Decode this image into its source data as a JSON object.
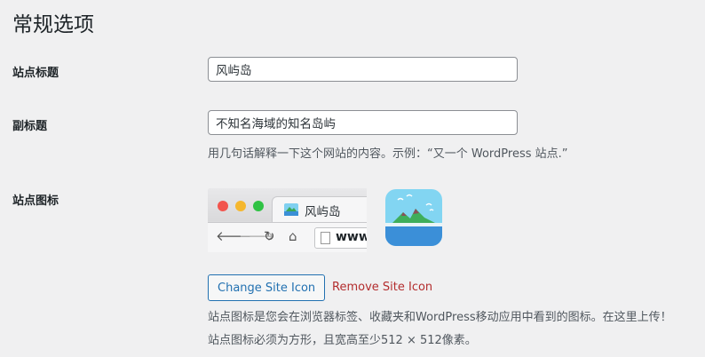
{
  "page": {
    "title": "常规选项"
  },
  "fields": {
    "site_title": {
      "label": "站点标题",
      "value": "风屿岛"
    },
    "tagline": {
      "label": "副标题",
      "value": "不知名海域的知名岛屿",
      "description": "用几句话解释一下这个网站的内容。示例：“又一个 WordPress 站点.”"
    },
    "site_icon": {
      "label": "站点图标",
      "preview": {
        "tab_title": "风屿岛",
        "address_text": "www."
      },
      "change_button": "Change Site Icon",
      "remove_link": "Remove Site Icon",
      "description_line1": "站点图标是您会在浏览器标签、收藏夹和WordPress移动应用中看到的图标。在这里上传！",
      "description_line2": "站点图标必须为方形，且宽高至少512 × 512像素。"
    }
  },
  "icons": {
    "browser_back": "back-arrow-icon",
    "browser_forward": "forward-arrow-icon",
    "browser_reload": "reload-icon",
    "browser_home": "home-icon"
  },
  "colors": {
    "background": "#f0f0f1",
    "accent": "#2271b1",
    "danger": "#b32d2e"
  }
}
